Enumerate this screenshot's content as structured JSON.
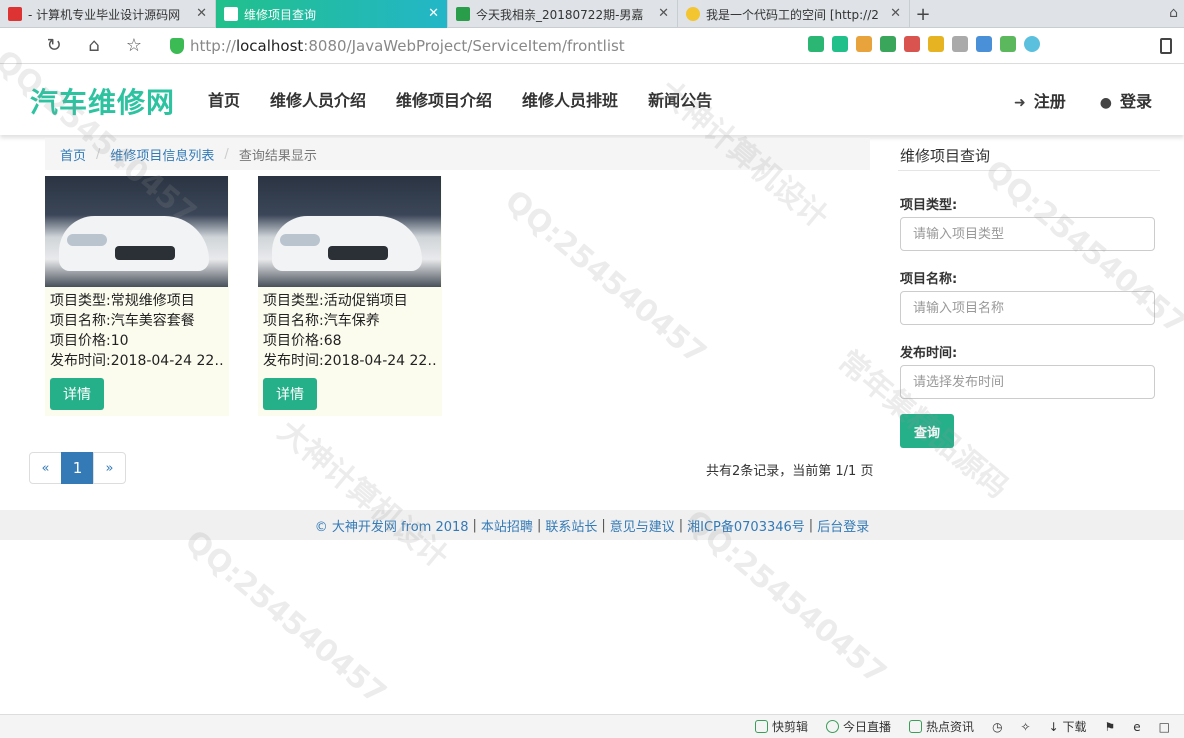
{
  "browser": {
    "tabs": [
      {
        "title": "- 计算机专业毕业设计源码网"
      },
      {
        "title": "维修项目查询"
      },
      {
        "title": "今天我相亲_20180722期-男嘉"
      },
      {
        "title": "我是一个代码工的空间 [http://2"
      }
    ],
    "address": {
      "prefix": "http://",
      "host": "localhost",
      "rest": ":8080/JavaWebProject/ServiceItem/frontlist"
    }
  },
  "header": {
    "logo": "汽车维修网",
    "nav": [
      "首页",
      "维修人员介绍",
      "维修项目介绍",
      "维修人员排班",
      "新闻公告"
    ],
    "register": "注册",
    "login": "登录"
  },
  "breadcrumb": {
    "home": "首页",
    "list": "维修项目信息列表",
    "current": "查询结果显示"
  },
  "items": [
    {
      "type": "项目类型:常规维修项目",
      "name": "项目名称:汽车美容套餐",
      "price": "项目价格:10",
      "time": "发布时间:2018-04-24 22…",
      "button": "详情"
    },
    {
      "type": "项目类型:活动促销项目",
      "name": "项目名称:汽车保养",
      "price": "项目价格:68",
      "time": "发布时间:2018-04-24 22…",
      "button": "详情"
    }
  ],
  "pager": {
    "prev": "«",
    "page": "1",
    "next": "»",
    "summary": "共有2条记录，当前第 1/1 页"
  },
  "sidebar": {
    "title": "维修项目查询",
    "type_label": "项目类型:",
    "type_placeholder": "请输入项目类型",
    "name_label": "项目名称:",
    "name_placeholder": "请输入项目名称",
    "time_label": "发布时间:",
    "time_placeholder": "请选择发布时间",
    "query": "查询"
  },
  "footer": {
    "copyright": "© 大神开发网 from 2018",
    "links": [
      "本站招聘",
      "联系站长",
      "意见与建议",
      "湘ICP备0703346号",
      "后台登录"
    ]
  },
  "statusbar": [
    "快剪辑",
    "今日直播",
    "热点资讯",
    "下载"
  ],
  "watermarks": [
    "QQ:254540457",
    "大神计算机设计",
    "常年集精品源码"
  ]
}
